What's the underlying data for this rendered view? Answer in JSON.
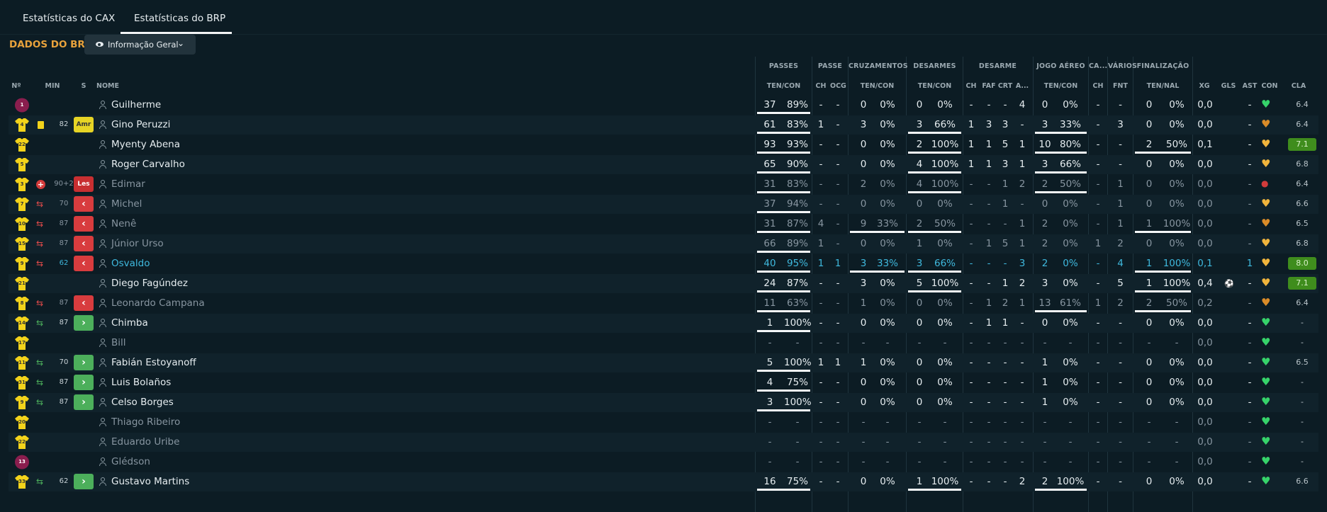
{
  "tabs": [
    {
      "label": "Estatísticas do CAX",
      "active": false
    },
    {
      "label": "Estatísticas do BRP",
      "active": true
    }
  ],
  "section_title": "DADOS DO BRP",
  "view_dropdown": {
    "icon": "eye-icon",
    "value": "Informação Geral"
  },
  "groups": [
    "PASSES",
    "PASSE",
    "CRUZAMENTOS",
    "DESARMES",
    "DESARME",
    "JOGO AÉREO",
    "CA...",
    "VÁRIOS",
    "FINALIZAÇÃO"
  ],
  "headers": [
    "Nº",
    "MIN",
    "S",
    "NOME",
    "TEN/CON",
    "CH",
    "OCG",
    "TEN/CON",
    "TEN/CON",
    "CH",
    "FAF",
    "CRT",
    "A...",
    "TEN/CON",
    "CH",
    "FNT",
    "TEN/NAL",
    "XG",
    "GLS",
    "AST",
    "CON",
    "CLA"
  ],
  "colors": {
    "bg": "#0c1c24",
    "accent": "#e8a23c",
    "green": "#4caf5b",
    "red": "#d83c3e",
    "blue": "#3fb9de",
    "yellow_shirt": "#f3d31b",
    "gk_shirt": "#8a1e4e"
  },
  "players": [
    {
      "num": "1",
      "gk": true,
      "name": "Guilherme",
      "event": "",
      "min": "",
      "badge": "",
      "cells": [
        "37",
        "89%",
        "-",
        "-",
        "0",
        "0%",
        "0",
        "0%",
        "-",
        "-",
        "-",
        "4",
        "0",
        "0%",
        "-",
        "-",
        "0",
        "0%",
        "0,0",
        "",
        "-"
      ],
      "bars": [
        1,
        0,
        0,
        0,
        0,
        0
      ],
      "con": "green",
      "cla": "6.4",
      "best": false,
      "dim": false,
      "blue": false
    },
    {
      "num": "4",
      "gk": false,
      "name": "Gino Peruzzi",
      "event": "card",
      "min": "82",
      "badge": "Amr",
      "cells": [
        "61",
        "83%",
        "1",
        "-",
        "3",
        "0%",
        "3",
        "66%",
        "1",
        "3",
        "3",
        "-",
        "3",
        "33%",
        "-",
        "3",
        "0",
        "0%",
        "0,0",
        "",
        "-"
      ],
      "bars": [
        1,
        0,
        0,
        1,
        1,
        0
      ],
      "con": "orange",
      "cla": "6.4",
      "best": false,
      "dim": false,
      "blue": false
    },
    {
      "num": "22",
      "gk": false,
      "name": "Myenty Abena",
      "event": "",
      "min": "",
      "badge": "",
      "cells": [
        "93",
        "93%",
        "-",
        "-",
        "0",
        "0%",
        "2",
        "100%",
        "1",
        "1",
        "5",
        "1",
        "10",
        "80%",
        "-",
        "-",
        "2",
        "50%",
        "0,1",
        "",
        "-"
      ],
      "bars": [
        1,
        0,
        0,
        1,
        1,
        1
      ],
      "con": "yellow",
      "cla": "7.1",
      "best": true,
      "dim": false,
      "blue": false
    },
    {
      "num": "5",
      "gk": false,
      "name": "Roger Carvalho",
      "event": "",
      "min": "",
      "badge": "",
      "cells": [
        "65",
        "90%",
        "-",
        "-",
        "0",
        "0%",
        "4",
        "100%",
        "1",
        "1",
        "3",
        "1",
        "3",
        "66%",
        "-",
        "-",
        "0",
        "0%",
        "0,0",
        "",
        "-"
      ],
      "bars": [
        1,
        0,
        0,
        1,
        1,
        0
      ],
      "con": "yellow",
      "cla": "6.8",
      "best": false,
      "dim": false,
      "blue": false
    },
    {
      "num": "3",
      "gk": false,
      "name": "Edimar",
      "event": "injury",
      "min": "90+2",
      "badge": "Les",
      "cells": [
        "31",
        "83%",
        "-",
        "-",
        "2",
        "0%",
        "4",
        "100%",
        "-",
        "-",
        "1",
        "2",
        "2",
        "50%",
        "-",
        "1",
        "0",
        "0%",
        "0,0",
        "",
        "-"
      ],
      "bars": [
        1,
        0,
        0,
        1,
        1,
        0
      ],
      "con": "red",
      "cla": "6.4",
      "best": false,
      "dim": true,
      "blue": false
    },
    {
      "num": "7",
      "gk": false,
      "name": "Michel",
      "event": "subout",
      "min": "70",
      "badge": "out",
      "cells": [
        "37",
        "94%",
        "-",
        "-",
        "0",
        "0%",
        "0",
        "0%",
        "-",
        "-",
        "1",
        "-",
        "0",
        "0%",
        "-",
        "1",
        "0",
        "0%",
        "0,0",
        "",
        "-"
      ],
      "bars": [
        1,
        0,
        0,
        0,
        0,
        0
      ],
      "con": "yellow",
      "cla": "6.6",
      "best": false,
      "dim": true,
      "blue": false
    },
    {
      "num": "10",
      "gk": false,
      "name": "Nenê",
      "event": "subout",
      "min": "87",
      "badge": "out",
      "cells": [
        "31",
        "87%",
        "4",
        "-",
        "9",
        "33%",
        "2",
        "50%",
        "-",
        "-",
        "-",
        "1",
        "2",
        "0%",
        "-",
        "1",
        "1",
        "100%",
        "0,0",
        "",
        "-"
      ],
      "bars": [
        1,
        0,
        1,
        1,
        0,
        1
      ],
      "con": "orange",
      "cla": "6.5",
      "best": false,
      "dim": true,
      "blue": false
    },
    {
      "num": "15",
      "gk": false,
      "name": "Júnior Urso",
      "event": "subout",
      "min": "87",
      "badge": "out",
      "cells": [
        "66",
        "89%",
        "1",
        "-",
        "0",
        "0%",
        "1",
        "0%",
        "-",
        "1",
        "5",
        "1",
        "2",
        "0%",
        "1",
        "2",
        "0",
        "0%",
        "0,0",
        "",
        "-"
      ],
      "bars": [
        1,
        0,
        0,
        0,
        0,
        0
      ],
      "con": "yellow",
      "cla": "6.8",
      "best": false,
      "dim": true,
      "blue": false
    },
    {
      "num": "9",
      "gk": false,
      "name": "Osvaldo",
      "event": "subout",
      "min": "62",
      "badge": "out",
      "cells": [
        "40",
        "95%",
        "1",
        "1",
        "3",
        "33%",
        "3",
        "66%",
        "-",
        "-",
        "-",
        "3",
        "2",
        "0%",
        "-",
        "4",
        "1",
        "100%",
        "0,1",
        "",
        "1"
      ],
      "bars": [
        1,
        0,
        1,
        1,
        0,
        1
      ],
      "con": "yellow",
      "cla": "8.0",
      "best": true,
      "dim": false,
      "blue": true
    },
    {
      "num": "21",
      "gk": false,
      "name": "Diego Fagúndez",
      "event": "",
      "min": "",
      "badge": "",
      "cells": [
        "24",
        "87%",
        "-",
        "-",
        "3",
        "0%",
        "5",
        "100%",
        "-",
        "-",
        "1",
        "2",
        "3",
        "0%",
        "-",
        "5",
        "1",
        "100%",
        "0,4",
        "ball",
        "-"
      ],
      "bars": [
        1,
        0,
        0,
        1,
        0,
        1
      ],
      "con": "yellow",
      "cla": "7.1",
      "best": true,
      "dim": false,
      "blue": false
    },
    {
      "num": "8",
      "gk": false,
      "name": "Leonardo Campana",
      "event": "subout",
      "min": "87",
      "badge": "out",
      "cells": [
        "11",
        "63%",
        "-",
        "-",
        "1",
        "0%",
        "0",
        "0%",
        "-",
        "1",
        "2",
        "1",
        "13",
        "61%",
        "1",
        "2",
        "2",
        "50%",
        "0,2",
        "",
        "-"
      ],
      "bars": [
        1,
        0,
        0,
        0,
        1,
        1
      ],
      "con": "orange",
      "cla": "6.4",
      "best": false,
      "dim": true,
      "blue": false
    },
    {
      "num": "14",
      "gk": false,
      "name": "Chimba",
      "event": "subin",
      "min": "87",
      "badge": "in",
      "cells": [
        "1",
        "100%",
        "-",
        "-",
        "0",
        "0%",
        "0",
        "0%",
        "-",
        "1",
        "1",
        "-",
        "0",
        "0%",
        "-",
        "-",
        "0",
        "0%",
        "0,0",
        "",
        "-"
      ],
      "bars": [
        1,
        0,
        0,
        0,
        0,
        0
      ],
      "con": "green",
      "cla": "-",
      "best": false,
      "dim": false,
      "blue": false
    },
    {
      "num": "17",
      "gk": false,
      "name": "Bill",
      "event": "",
      "min": "",
      "badge": "",
      "cells": [
        "-",
        "-",
        "-",
        "-",
        "-",
        "-",
        "-",
        "-",
        "-",
        "-",
        "-",
        "-",
        "-",
        "-",
        "-",
        "-",
        "-",
        "-",
        "0,0",
        "",
        "-"
      ],
      "bars": [
        0,
        0,
        0,
        0,
        0,
        0
      ],
      "con": "green",
      "cla": "-",
      "best": false,
      "dim": true,
      "blue": false
    },
    {
      "num": "11",
      "gk": false,
      "name": "Fabián Estoyanoff",
      "event": "subin",
      "min": "70",
      "badge": "in",
      "cells": [
        "5",
        "100%",
        "1",
        "1",
        "1",
        "0%",
        "0",
        "0%",
        "-",
        "-",
        "-",
        "-",
        "1",
        "0%",
        "-",
        "-",
        "0",
        "0%",
        "0,0",
        "",
        "-"
      ],
      "bars": [
        1,
        0,
        0,
        0,
        0,
        0
      ],
      "con": "green",
      "cla": "6.5",
      "best": false,
      "dim": false,
      "blue": false
    },
    {
      "num": "31",
      "gk": false,
      "name": "Luis Bolaños",
      "event": "subin",
      "min": "87",
      "badge": "in",
      "cells": [
        "4",
        "75%",
        "-",
        "-",
        "0",
        "0%",
        "0",
        "0%",
        "-",
        "-",
        "-",
        "-",
        "1",
        "0%",
        "-",
        "-",
        "0",
        "0%",
        "0,0",
        "",
        "-"
      ],
      "bars": [
        1,
        0,
        0,
        0,
        0,
        0
      ],
      "con": "green",
      "cla": "-",
      "best": false,
      "dim": false,
      "blue": false
    },
    {
      "num": "9",
      "gk": false,
      "name": "Celso Borges",
      "event": "subin",
      "min": "87",
      "badge": "in",
      "cells": [
        "3",
        "100%",
        "-",
        "-",
        "0",
        "0%",
        "0",
        "0%",
        "-",
        "-",
        "-",
        "-",
        "1",
        "0%",
        "-",
        "-",
        "0",
        "0%",
        "0,0",
        "",
        "-"
      ],
      "bars": [
        1,
        0,
        0,
        0,
        0,
        0
      ],
      "con": "green",
      "cla": "-",
      "best": false,
      "dim": false,
      "blue": false
    },
    {
      "num": "20",
      "gk": false,
      "name": "Thiago Ribeiro",
      "event": "",
      "min": "",
      "badge": "",
      "cells": [
        "-",
        "-",
        "-",
        "-",
        "-",
        "-",
        "-",
        "-",
        "-",
        "-",
        "-",
        "-",
        "-",
        "-",
        "-",
        "-",
        "-",
        "-",
        "0,0",
        "",
        "-"
      ],
      "bars": [
        0,
        0,
        0,
        0,
        0,
        0
      ],
      "con": "green",
      "cla": "-",
      "best": false,
      "dim": true,
      "blue": false
    },
    {
      "num": "22",
      "gk": false,
      "name": "Eduardo Uribe",
      "event": "",
      "min": "",
      "badge": "",
      "cells": [
        "-",
        "-",
        "-",
        "-",
        "-",
        "-",
        "-",
        "-",
        "-",
        "-",
        "-",
        "-",
        "-",
        "-",
        "-",
        "-",
        "-",
        "-",
        "0,0",
        "",
        "-"
      ],
      "bars": [
        0,
        0,
        0,
        0,
        0,
        0
      ],
      "con": "green",
      "cla": "-",
      "best": false,
      "dim": true,
      "blue": false
    },
    {
      "num": "13",
      "gk": true,
      "name": "Glédson",
      "event": "",
      "min": "",
      "badge": "",
      "cells": [
        "-",
        "-",
        "-",
        "-",
        "-",
        "-",
        "-",
        "-",
        "-",
        "-",
        "-",
        "-",
        "-",
        "-",
        "-",
        "-",
        "-",
        "-",
        "0,0",
        "",
        "-"
      ],
      "bars": [
        0,
        0,
        0,
        0,
        0,
        0
      ],
      "con": "green",
      "cla": "-",
      "best": false,
      "dim": true,
      "blue": false
    },
    {
      "num": "33",
      "gk": false,
      "name": "Gustavo Martins",
      "event": "subin",
      "min": "62",
      "badge": "in",
      "cells": [
        "16",
        "75%",
        "-",
        "-",
        "0",
        "0%",
        "1",
        "100%",
        "-",
        "-",
        "-",
        "2",
        "2",
        "100%",
        "-",
        "-",
        "0",
        "0%",
        "0,0",
        "",
        "-"
      ],
      "bars": [
        1,
        0,
        0,
        1,
        1,
        0
      ],
      "con": "green",
      "cla": "6.6",
      "best": false,
      "dim": false,
      "blue": false
    }
  ]
}
